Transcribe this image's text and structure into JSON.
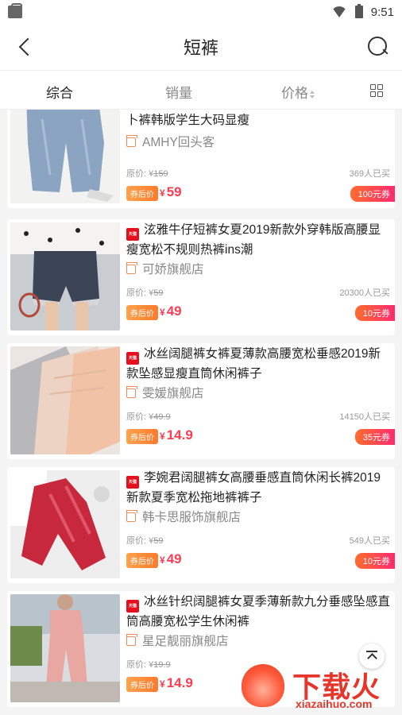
{
  "status": {
    "time": "9:51"
  },
  "nav": {
    "title": "短裤"
  },
  "tabs": [
    {
      "label": "综合"
    },
    {
      "label": "销量"
    },
    {
      "label": "价格"
    }
  ],
  "products": [
    {
      "title": "卜裤韩版学生大码显瘦",
      "shop": "AMHY回头客",
      "orig_label": "原价: ¥",
      "orig_price": "159",
      "sold": "369人已买",
      "coupon_badge": "券后价",
      "price": "59",
      "coupon": "100元券"
    },
    {
      "title": "泫雅牛仔短裤女夏2019新款外穿韩版高腰显瘦宽松不规则热裤ins潮",
      "shop": "可娇旗舰店",
      "orig_label": "原价: ¥",
      "orig_price": "59",
      "sold": "20300人已买",
      "coupon_badge": "券后价",
      "price": "49",
      "coupon": "10元券"
    },
    {
      "title": "冰丝阔腿裤女裤夏薄款高腰宽松垂感2019新款坠感显瘦直筒休闲裤子",
      "shop": "雯媛旗舰店",
      "orig_label": "原价: ¥",
      "orig_price": "49.9",
      "sold": "14150人已买",
      "coupon_badge": "券后价",
      "price": "14.9",
      "coupon": "35元券"
    },
    {
      "title": "李婉君阔腿裤女高腰垂感直筒休闲长裤2019新款夏季宽松拖地裤裤子",
      "shop": "韩卡思服饰旗舰店",
      "orig_label": "原价: ¥",
      "orig_price": "59",
      "sold": "549人已买",
      "coupon_badge": "券后价",
      "price": "49",
      "coupon": "10元券"
    },
    {
      "title": "冰丝针织阔腿裤女夏季薄新款九分垂感坠感直筒高腰宽松学生休闲裤",
      "shop": "星足靓丽旗舰店",
      "orig_label": "原价: ¥",
      "orig_price": "19.9",
      "sold": "",
      "coupon_badge": "券后价",
      "price": "14.9",
      "coupon": ""
    }
  ],
  "common": {
    "yen": "¥",
    "tmall_icon": "天猫"
  },
  "watermark": {
    "text": "下载火",
    "url": "xiazaihuo.com"
  }
}
